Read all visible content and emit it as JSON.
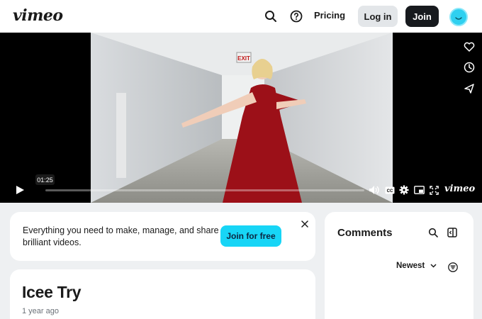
{
  "header": {
    "logo": "vimeo",
    "search_icon": "search-icon",
    "help_icon": "help-icon",
    "pricing_label": "Pricing",
    "login_label": "Log in",
    "join_label": "Join",
    "avatar_icon": "avatar-smile-icon"
  },
  "player": {
    "current_time": "01:25",
    "progress_fraction": 0.0,
    "side_actions": [
      "heart-icon",
      "clock-icon",
      "send-icon"
    ],
    "controls": [
      "play-icon",
      "volume-icon",
      "cc-icon",
      "settings-icon",
      "pip-icon",
      "fullscreen-icon"
    ],
    "brand": "vimeo"
  },
  "promo": {
    "text": "Everything you need to make, manage, and share brilliant videos.",
    "button_label": "Join for free"
  },
  "video": {
    "title": "Icee Try",
    "age": "1 year ago"
  },
  "comments": {
    "title": "Comments",
    "sort_label": "Newest"
  },
  "colors": {
    "accent": "#17d5f6",
    "dark_button": "#171a1e",
    "page_bg": "#eef0f2"
  }
}
